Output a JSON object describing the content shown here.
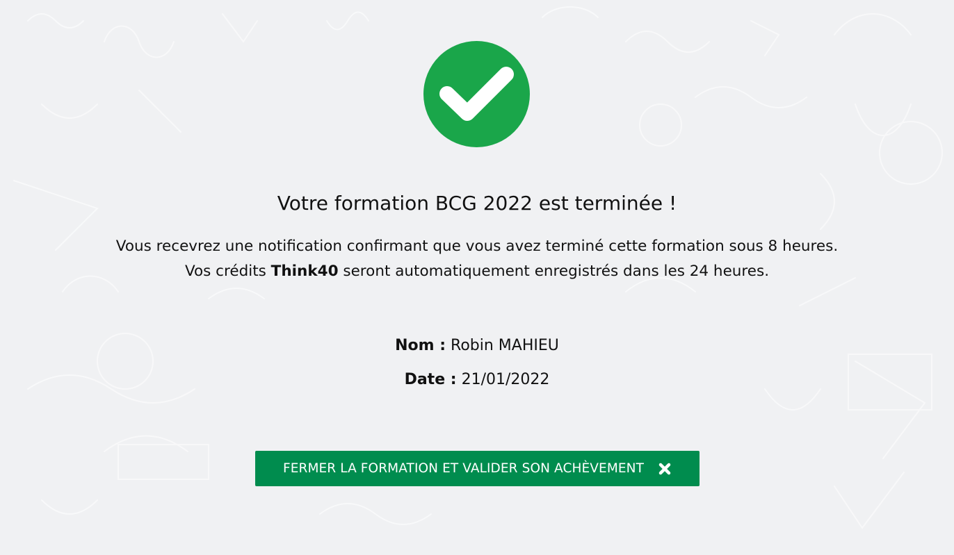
{
  "status_icon": "check-circle-icon",
  "colors": {
    "success_green": "#1aa64a",
    "button_green": "#008c4e",
    "background": "#f0f1f3"
  },
  "headline": "Votre formation BCG 2022 est terminée !",
  "message": {
    "line1": "Vous recevrez une notification confirmant que vous avez terminé cette formation sous 8 heures.",
    "line2_prefix": "Vos crédits ",
    "line2_brand": "Think40",
    "line2_suffix": " seront automatiquement enregistrés dans les 24 heures."
  },
  "details": {
    "name_label": "Nom :",
    "name_value": "Robin MAHIEU",
    "date_label": "Date :",
    "date_value": "21/01/2022"
  },
  "close_button": {
    "label": "FERMER LA FORMATION ET VALIDER SON ACHÈVEMENT",
    "icon": "close-icon"
  }
}
